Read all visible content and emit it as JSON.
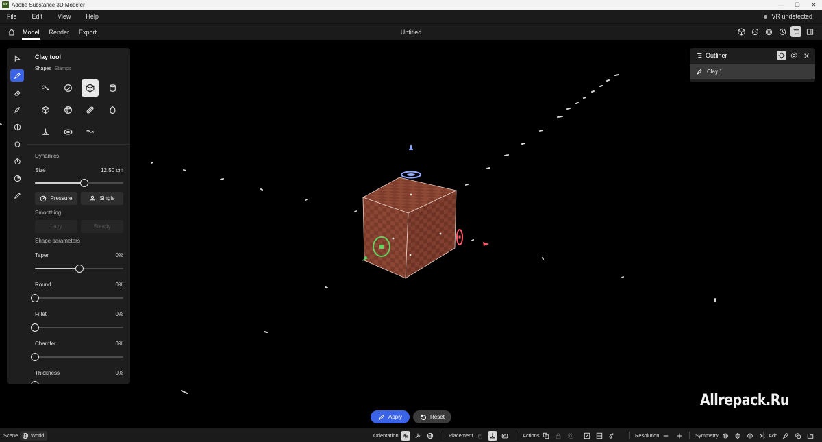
{
  "titlebar": {
    "app_icon_text": "Md",
    "title": "Adobe Substance 3D Modeler"
  },
  "menu": {
    "items": [
      "File",
      "Edit",
      "View",
      "Help"
    ],
    "vr_status": "VR undetected"
  },
  "tabs": {
    "items": [
      "Model",
      "Render",
      "Export"
    ],
    "active": "Model",
    "document_title": "Untitled"
  },
  "tools": [
    "select-icon",
    "clay-brush-icon",
    "eraser-icon",
    "smooth-icon",
    "symmetry-icon",
    "inflate-icon",
    "timer-icon",
    "stamp-icon",
    "paint-brush-icon"
  ],
  "panel": {
    "title": "Clay tool",
    "subtabs": [
      "Shapes",
      "Stamps"
    ],
    "active_subtab": "Shapes",
    "shapes": [
      "capsule-shape",
      "sphere-shape",
      "cube-shape",
      "cylinder-shape",
      "polyhedron-shape",
      "ball-shape",
      "pill-shape",
      "egg-shape",
      "cone-shape",
      "torus-shape",
      "curve-shape"
    ],
    "selected_shape": "cube-shape",
    "dynamics_label": "Dynamics",
    "size": {
      "label": "Size",
      "value": "12.50 cm",
      "fraction": 0.56
    },
    "pressure_label": "Pressure",
    "single_label": "Single",
    "smoothing_label": "Smoothing",
    "lazy_label": "Lazy",
    "steady_label": "Steady",
    "shape_params_label": "Shape parameters",
    "taper": {
      "label": "Taper",
      "value": "0%",
      "fraction": 0.5
    },
    "round": {
      "label": "Round",
      "value": "0%",
      "fraction": 0
    },
    "fillet": {
      "label": "Fillet",
      "value": "0%",
      "fraction": 0
    },
    "chamfer": {
      "label": "Chamfer",
      "value": "0%",
      "fraction": 0
    },
    "thickness": {
      "label": "Thickness",
      "value": "0%",
      "fraction": 0
    }
  },
  "outliner": {
    "title": "Outliner",
    "items": [
      "Clay 1"
    ]
  },
  "actions": {
    "apply": "Apply",
    "reset": "Reset"
  },
  "watermark": "Allrepack.Ru",
  "statusbar": {
    "scene": "Scene",
    "world": "World",
    "orientation": "Orientation",
    "placement": "Placement",
    "actions": "Actions",
    "resolution": "Resolution",
    "symmetry": "Symmetry",
    "add": "Add"
  },
  "colors": {
    "accent": "#3b63e8",
    "cube_base": "#7a3a2a",
    "cube_checker": "#8f4a36",
    "gizmo_green": "#5fd35f",
    "gizmo_red": "#ff5a6a",
    "gizmo_blue": "#8fa8ff"
  }
}
